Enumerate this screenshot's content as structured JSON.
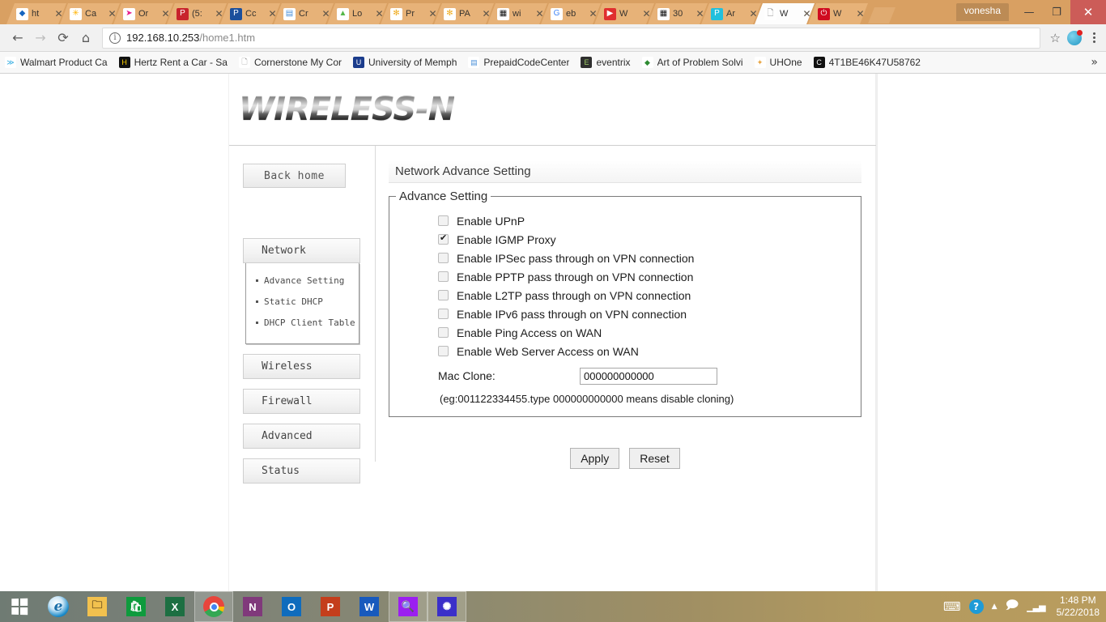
{
  "browser": {
    "tabs": [
      {
        "label": "ht",
        "icon": "blue-diamond-icon",
        "icon_glyph": "◆",
        "icon_color": "#1565c0",
        "icon_bg": "#ffffff",
        "active": false
      },
      {
        "label": "Ca",
        "icon": "walmart-spark-icon",
        "icon_glyph": "✳",
        "icon_color": "#ffb300",
        "icon_bg": "#ffffff",
        "active": false
      },
      {
        "label": "Or",
        "icon": "pink-bird-icon",
        "icon_glyph": "➤",
        "icon_color": "#e91e8c",
        "icon_bg": "#ffffff",
        "active": false
      },
      {
        "label": "(5:",
        "icon": "pinterest-icon",
        "icon_glyph": "P",
        "icon_color": "#ffffff",
        "icon_bg": "#c8232c",
        "active": false
      },
      {
        "label": "Cc",
        "icon": "paypal-icon",
        "icon_glyph": "P",
        "icon_color": "#ffffff",
        "icon_bg": "#1b4f9c",
        "active": false
      },
      {
        "label": "Cr",
        "icon": "document-icon",
        "icon_glyph": "▤",
        "icon_color": "#4a90d9",
        "icon_bg": "#ffffff",
        "active": false
      },
      {
        "label": "Lo",
        "icon": "green-triangle-icon",
        "icon_glyph": "▲",
        "icon_color": "#55b848",
        "icon_bg": "#ffffff",
        "active": false
      },
      {
        "label": "Pr",
        "icon": "butterfly-icon",
        "icon_glyph": "✻",
        "icon_color": "#f0ad22",
        "icon_bg": "#ffffff",
        "active": false
      },
      {
        "label": "PA",
        "icon": "butterfly-icon",
        "icon_glyph": "✻",
        "icon_color": "#f0ad22",
        "icon_bg": "#ffffff",
        "active": false
      },
      {
        "label": "wi",
        "icon": "shopping-bag-icon",
        "icon_glyph": "▦",
        "icon_color": "#111111",
        "icon_bg": "#ffffff",
        "active": false
      },
      {
        "label": "eb",
        "icon": "google-icon",
        "icon_glyph": "G",
        "icon_color": "#4285f4",
        "icon_bg": "#ffffff",
        "active": false
      },
      {
        "label": "W",
        "icon": "youtube-icon",
        "icon_glyph": "▶",
        "icon_color": "#ffffff",
        "icon_bg": "#e02f2f",
        "active": false
      },
      {
        "label": "30",
        "icon": "shopping-bag-icon",
        "icon_glyph": "▦",
        "icon_color": "#111111",
        "icon_bg": "#ffffff",
        "active": false
      },
      {
        "label": "Ar",
        "icon": "cyan-app-icon",
        "icon_glyph": "P",
        "icon_color": "#ffffff",
        "icon_bg": "#22c0dd",
        "active": false
      },
      {
        "label": "W",
        "icon": "blank-page-icon",
        "icon_glyph": "🗋",
        "icon_color": "#8a8a8a",
        "icon_bg": "#ffffff",
        "active": true
      },
      {
        "label": "W",
        "icon": "power-icon",
        "icon_glyph": "⏻",
        "icon_color": "#ffffff",
        "icon_bg": "#d00b20",
        "active": false
      }
    ],
    "window": {
      "user": "vonesha",
      "minimize": "—",
      "restore": "❐",
      "close": "✕"
    },
    "nav": {
      "back": "←",
      "forward": "→",
      "reload": "⟳",
      "home": "⌂",
      "info_icon": "ⓘ",
      "url_host": "192.168.10.253",
      "url_path": "/home1.htm",
      "bookmark_star": "☆",
      "menu": "kebab-menu"
    },
    "bookmarks": [
      {
        "label": "Walmart Product Ca",
        "icon_glyph": "≫",
        "icon_color": "#29a8e0",
        "icon_bg": "#ffffff"
      },
      {
        "label": "Hertz Rent a Car - Sa",
        "icon_glyph": "H",
        "icon_color": "#ffd200",
        "icon_bg": "#111111"
      },
      {
        "label": "Cornerstone My Cor",
        "icon_glyph": "🗋",
        "icon_color": "#888888",
        "icon_bg": "#ffffff"
      },
      {
        "label": "University of Memph",
        "icon_glyph": "U",
        "icon_color": "#ffffff",
        "icon_bg": "#1b3c8c"
      },
      {
        "label": "PrepaidCodeCenter",
        "icon_glyph": "▤",
        "icon_color": "#4a90d9",
        "icon_bg": "#ffffff"
      },
      {
        "label": "eventrix",
        "icon_glyph": "E",
        "icon_color": "#9ccc65",
        "icon_bg": "#2e2e2e"
      },
      {
        "label": "Art of Problem Solvi",
        "icon_glyph": "◆",
        "icon_color": "#2e8b32",
        "icon_bg": "#ffffff"
      },
      {
        "label": "UHOne",
        "icon_glyph": "✦",
        "icon_color": "#e8a33d",
        "icon_bg": "#ffffff"
      },
      {
        "label": "4T1BE46K47U58762",
        "icon_glyph": "C",
        "icon_color": "#ffffff",
        "icon_bg": "#111111"
      }
    ],
    "bookmarks_overflow": "»"
  },
  "router": {
    "logo": "WIRELESS-N",
    "sidebar": {
      "back_home": "Back home",
      "groups": [
        {
          "name": "Network",
          "expanded": true,
          "items": [
            "Advance Setting",
            "Static DHCP",
            "DHCP Client Table"
          ]
        }
      ],
      "single_items": [
        "Wireless",
        "Firewall",
        "Advanced",
        "Status"
      ]
    },
    "panel": {
      "title": "Network Advance Setting",
      "legend": "Advance Setting",
      "checkboxes": [
        {
          "label": "Enable UPnP",
          "checked": false
        },
        {
          "label": "Enable IGMP Proxy",
          "checked": true
        },
        {
          "label": "Enable IPSec pass through on VPN connection",
          "checked": false
        },
        {
          "label": "Enable PPTP pass through on VPN connection",
          "checked": false
        },
        {
          "label": "Enable L2TP pass through on VPN connection",
          "checked": false
        },
        {
          "label": "Enable IPv6 pass through on VPN connection",
          "checked": false
        },
        {
          "label": "Enable Ping Access on WAN",
          "checked": false
        },
        {
          "label": "Enable Web Server Access on WAN",
          "checked": false
        }
      ],
      "mac_clone_label": "Mac Clone:",
      "mac_clone_value": "000000000000",
      "mac_clone_hint": "(eg:001122334455.type 000000000000 means disable cloning)",
      "apply_button": "Apply",
      "reset_button": "Reset"
    }
  },
  "taskbar": {
    "items": [
      {
        "name": "start-button",
        "glyph": "",
        "kind": "windows",
        "running": false
      },
      {
        "name": "internet-explorer",
        "glyph": "e",
        "kind": "ie",
        "running": false
      },
      {
        "name": "file-explorer",
        "glyph": "🗀",
        "bg": "#f2c14e",
        "fg": "#6d5220",
        "running": false
      },
      {
        "name": "microsoft-store",
        "glyph": "🛍",
        "bg": "#0e9b3d",
        "fg": "#ffffff",
        "running": false
      },
      {
        "name": "excel",
        "glyph": "X",
        "bg": "#1d6f42",
        "fg": "#ffffff",
        "running": false
      },
      {
        "name": "chrome",
        "glyph": "",
        "kind": "chrome",
        "running": true
      },
      {
        "name": "onenote",
        "glyph": "N",
        "bg": "#80397b",
        "fg": "#ffffff",
        "running": false
      },
      {
        "name": "outlook",
        "glyph": "O",
        "bg": "#0f6cbd",
        "fg": "#ffffff",
        "running": false
      },
      {
        "name": "powerpoint",
        "glyph": "P",
        "bg": "#c43e1c",
        "fg": "#ffffff",
        "running": false
      },
      {
        "name": "word",
        "glyph": "W",
        "bg": "#185abd",
        "fg": "#ffffff",
        "running": false
      },
      {
        "name": "search",
        "glyph": "🔍",
        "bg": "#9b1ff0",
        "fg": "#ffffff",
        "running": true
      },
      {
        "name": "settings",
        "glyph": "✺",
        "bg": "#3b2fc9",
        "fg": "#ffffff",
        "running": true
      }
    ],
    "tray": {
      "keyboard": "⌨",
      "help": "?",
      "show_hidden": "▲",
      "action_center": "🗩",
      "network": "▁▃▅",
      "time": "1:48 PM",
      "date": "5/22/2018"
    }
  }
}
